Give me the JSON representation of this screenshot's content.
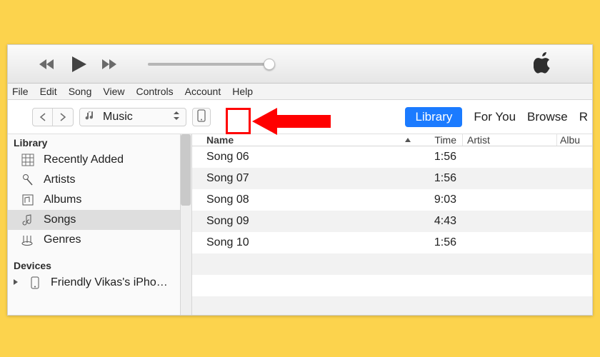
{
  "menubar": [
    "File",
    "Edit",
    "Song",
    "View",
    "Controls",
    "Account",
    "Help"
  ],
  "media_picker": {
    "label": "Music"
  },
  "view_tabs": {
    "active": "Library",
    "others": [
      "For You",
      "Browse",
      "R"
    ]
  },
  "sidebar": {
    "library_title": "Library",
    "devices_title": "Devices",
    "items": [
      {
        "label": "Recently Added",
        "icon": "grid"
      },
      {
        "label": "Artists",
        "icon": "mic"
      },
      {
        "label": "Albums",
        "icon": "album"
      },
      {
        "label": "Songs",
        "icon": "note",
        "selected": true
      },
      {
        "label": "Genres",
        "icon": "guitar"
      }
    ],
    "devices": [
      {
        "label": "Friendly Vikas's iPho…",
        "icon": "phone"
      }
    ]
  },
  "columns": {
    "name": "Name",
    "time": "Time",
    "artist": "Artist",
    "album": "Albu"
  },
  "songs": [
    {
      "name": "Song 06",
      "time": "1:56"
    },
    {
      "name": "Song 07",
      "time": "1:56"
    },
    {
      "name": "Song 08",
      "time": "9:03"
    },
    {
      "name": "Song 09",
      "time": "4:43"
    },
    {
      "name": "Song 10",
      "time": "1:56"
    }
  ],
  "colors": {
    "accent": "#1b7bff",
    "annotation": "#ff0000"
  }
}
